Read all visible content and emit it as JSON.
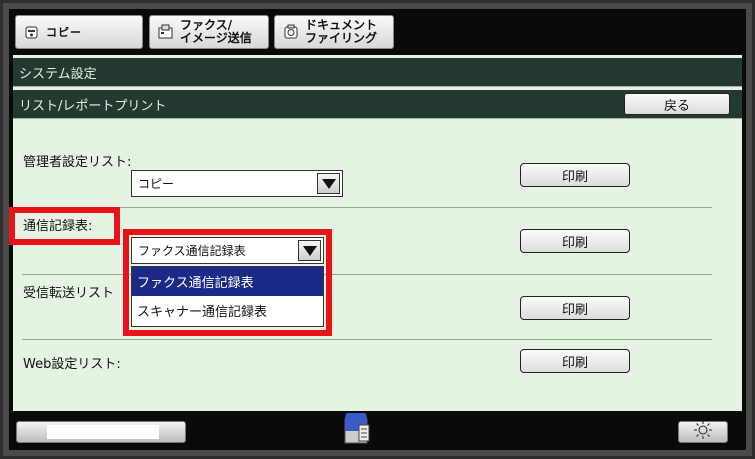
{
  "tabs": {
    "copy": {
      "label": "コピー",
      "icon": "copy-icon"
    },
    "fax": {
      "line1": "ファクス/",
      "line2": "イメージ送信",
      "icon": "fax-icon"
    },
    "doc": {
      "line1": "ドキュメント",
      "line2": "ファイリング",
      "icon": "document-filing-icon"
    }
  },
  "header": {
    "title": "システム設定",
    "subtitle": "リスト/レポートプリント",
    "back_label": "戻る"
  },
  "rows": {
    "admin": {
      "label": "管理者設定リスト:",
      "select_value": "コピー",
      "print_label": "印刷"
    },
    "log": {
      "label": "通信記録表:",
      "select_value": "ファクス通信記録表",
      "print_label": "印刷",
      "options": [
        "ファクス通信記録表",
        "スキャナー通信記録表"
      ]
    },
    "forward": {
      "label": "受信転送リスト",
      "print_label": "印刷"
    },
    "web": {
      "label": "Web設定リスト:",
      "print_label": "印刷"
    }
  },
  "colors": {
    "header_bar": "#243a31",
    "panel_bg": "#e4f3e2",
    "highlight": "#e8141a",
    "selected": "#1b2a86"
  }
}
